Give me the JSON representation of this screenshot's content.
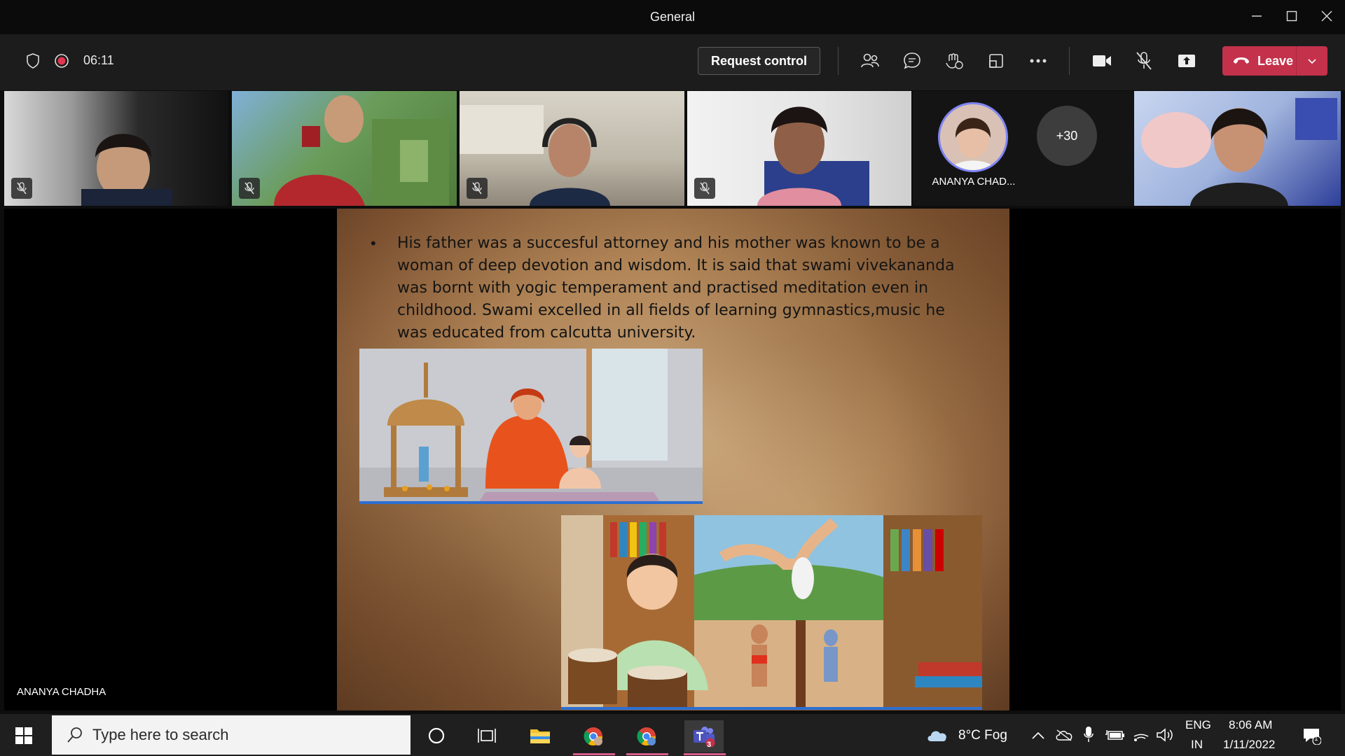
{
  "window": {
    "title": "General"
  },
  "toolbar": {
    "timer": "06:11",
    "request_control_label": "Request control",
    "leave_label": "Leave"
  },
  "participants": {
    "avatar_name": "ANANYA CHAD...",
    "overflow_count": "+30"
  },
  "slide": {
    "bullet": "•",
    "text": "His father was a succesful attorney and his mother was known to be a woman of deep devotion and wisdom. It is said that swami vivekananda was bornt with yogic temperament and practised meditation even in childhood. Swami excelled in all fields of learning gymnastics,music he was educated from calcutta university."
  },
  "stage": {
    "speaker_name": "ANANYA CHADHA"
  },
  "taskbar": {
    "search_placeholder": "Type here to search",
    "weather": "8°C  Fog",
    "lang_top": "ENG",
    "lang_bottom": "IN",
    "time": "8:06 AM",
    "date": "1/11/2022",
    "teams_badge": "3",
    "notification_count": "1"
  },
  "colors": {
    "leave": "#c4314b",
    "avatar_ring": "#7f85f5",
    "record": "#e0364f"
  }
}
